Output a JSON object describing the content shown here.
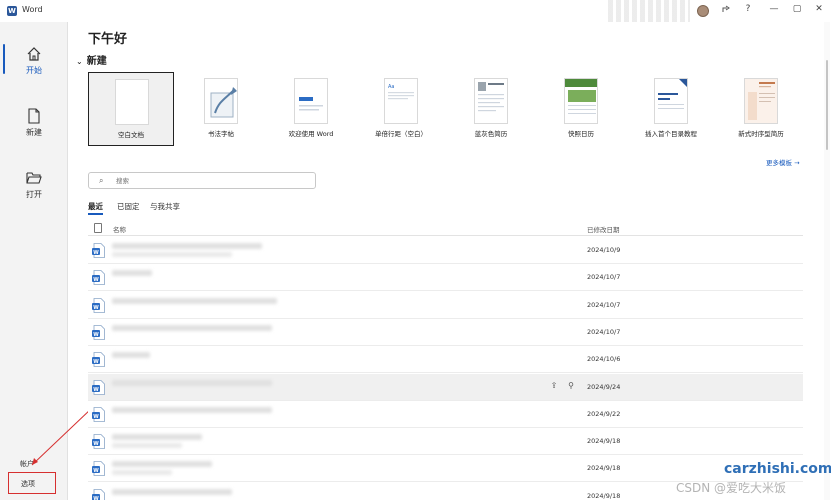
{
  "app": {
    "title": "Word",
    "icon_letter": "W"
  },
  "titlebar": {
    "help_label": "?",
    "minimize_label": "—",
    "maximize_label": "▢"
  },
  "nav": {
    "home_label": "开始",
    "new_label": "新建",
    "open_label": "打开",
    "account_label": "帐户",
    "options_label": "选项"
  },
  "greeting": "下午好",
  "new_section": {
    "title": "新建",
    "templates": [
      {
        "label": "空白文档"
      },
      {
        "label": "书法字帖"
      },
      {
        "label": "欢迎使用 Word"
      },
      {
        "label": "单倍行距（空白）"
      },
      {
        "label": "蓝灰色简历"
      },
      {
        "label": "快照日历"
      },
      {
        "label": "插入首个目录教程"
      },
      {
        "label": "新式时序型简历"
      }
    ],
    "more_label": "更多模板"
  },
  "search": {
    "placeholder": "搜索"
  },
  "tabs": [
    {
      "label": "最近"
    },
    {
      "label": "已固定"
    },
    {
      "label": "与我共享"
    }
  ],
  "list": {
    "col_name": "名称",
    "col_date": "已修改日期",
    "rows": [
      {
        "date": "2024/10/9"
      },
      {
        "date": "2024/10/7"
      },
      {
        "date": "2024/10/7"
      },
      {
        "date": "2024/10/7"
      },
      {
        "date": "2024/10/6"
      },
      {
        "date": "2024/9/24"
      },
      {
        "date": "2024/9/22"
      },
      {
        "date": "2024/9/18"
      },
      {
        "date": "2024/9/18"
      },
      {
        "date": "2024/9/18"
      }
    ]
  },
  "watermark": {
    "site": "carzhishi.com",
    "csdn": "CSDN @爱吃大米饭"
  },
  "colors": {
    "accent": "#185abd",
    "word_blue": "#2b579a",
    "highlight_red": "#d62f2f"
  }
}
